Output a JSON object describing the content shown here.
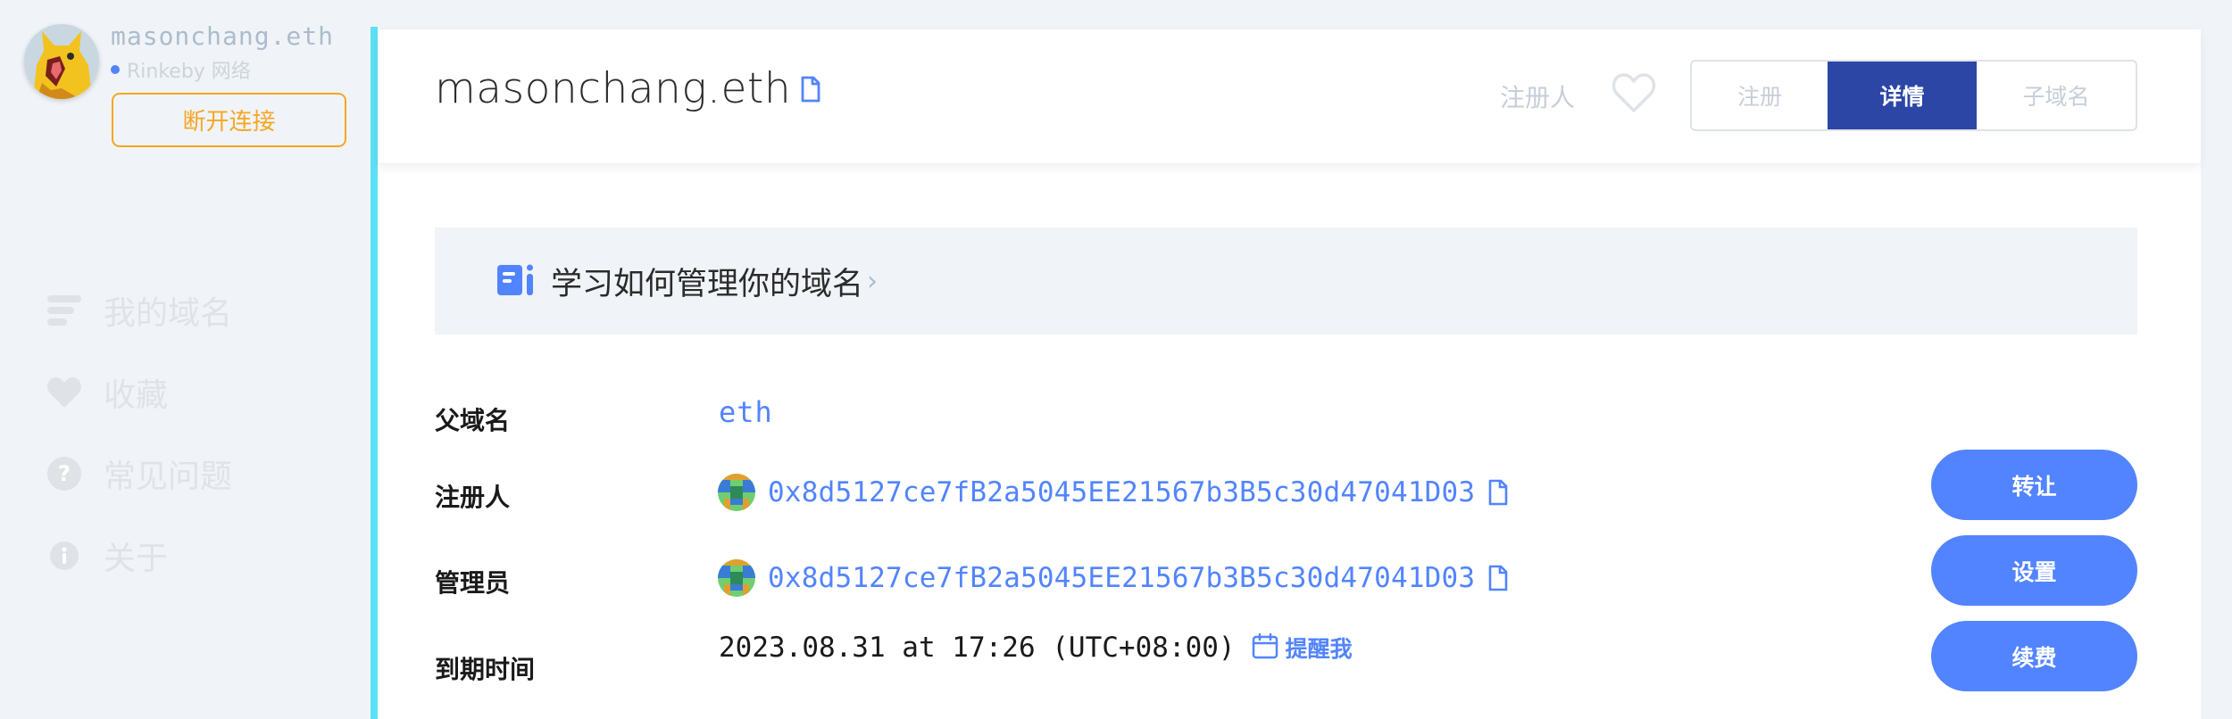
{
  "account": {
    "name": "masonchang.eth",
    "network": "Rinkeby 网络",
    "disconnect_label": "断开连接"
  },
  "sidebar": {
    "items": [
      {
        "label": "我的域名",
        "icon": "list-icon"
      },
      {
        "label": "收藏",
        "icon": "heart-icon"
      },
      {
        "label": "常见问题",
        "icon": "question-icon"
      },
      {
        "label": "关于",
        "icon": "info-icon"
      }
    ]
  },
  "header": {
    "domain": "masonchang.eth",
    "registrant_link": "注册人",
    "tabs": [
      {
        "label": "注册",
        "active": false
      },
      {
        "label": "详情",
        "active": true
      },
      {
        "label": "子域名",
        "active": false
      }
    ]
  },
  "learn_banner": {
    "text": "学习如何管理你的域名",
    "chevron": "›"
  },
  "details": {
    "parent": {
      "label": "父域名",
      "value": "eth"
    },
    "registrant": {
      "label": "注册人",
      "address": "0x8d5127ce7fB2a5045EE21567b3B5c30d47041D03",
      "button": "转让"
    },
    "controller": {
      "label": "管理员",
      "address": "0x8d5127ce7fB2a5045EE21567b3B5c30d47041D03",
      "button": "设置"
    },
    "expiry": {
      "label": "到期时间",
      "value": "2023.08.31 at 17:26 (UTC+08:00)",
      "remind": "提醒我",
      "button": "续费"
    }
  },
  "colors": {
    "accent": "#5284ff",
    "tab_active": "#2c46a6",
    "warning": "#f5a623",
    "sidebar_accent": "#5be1f5"
  }
}
